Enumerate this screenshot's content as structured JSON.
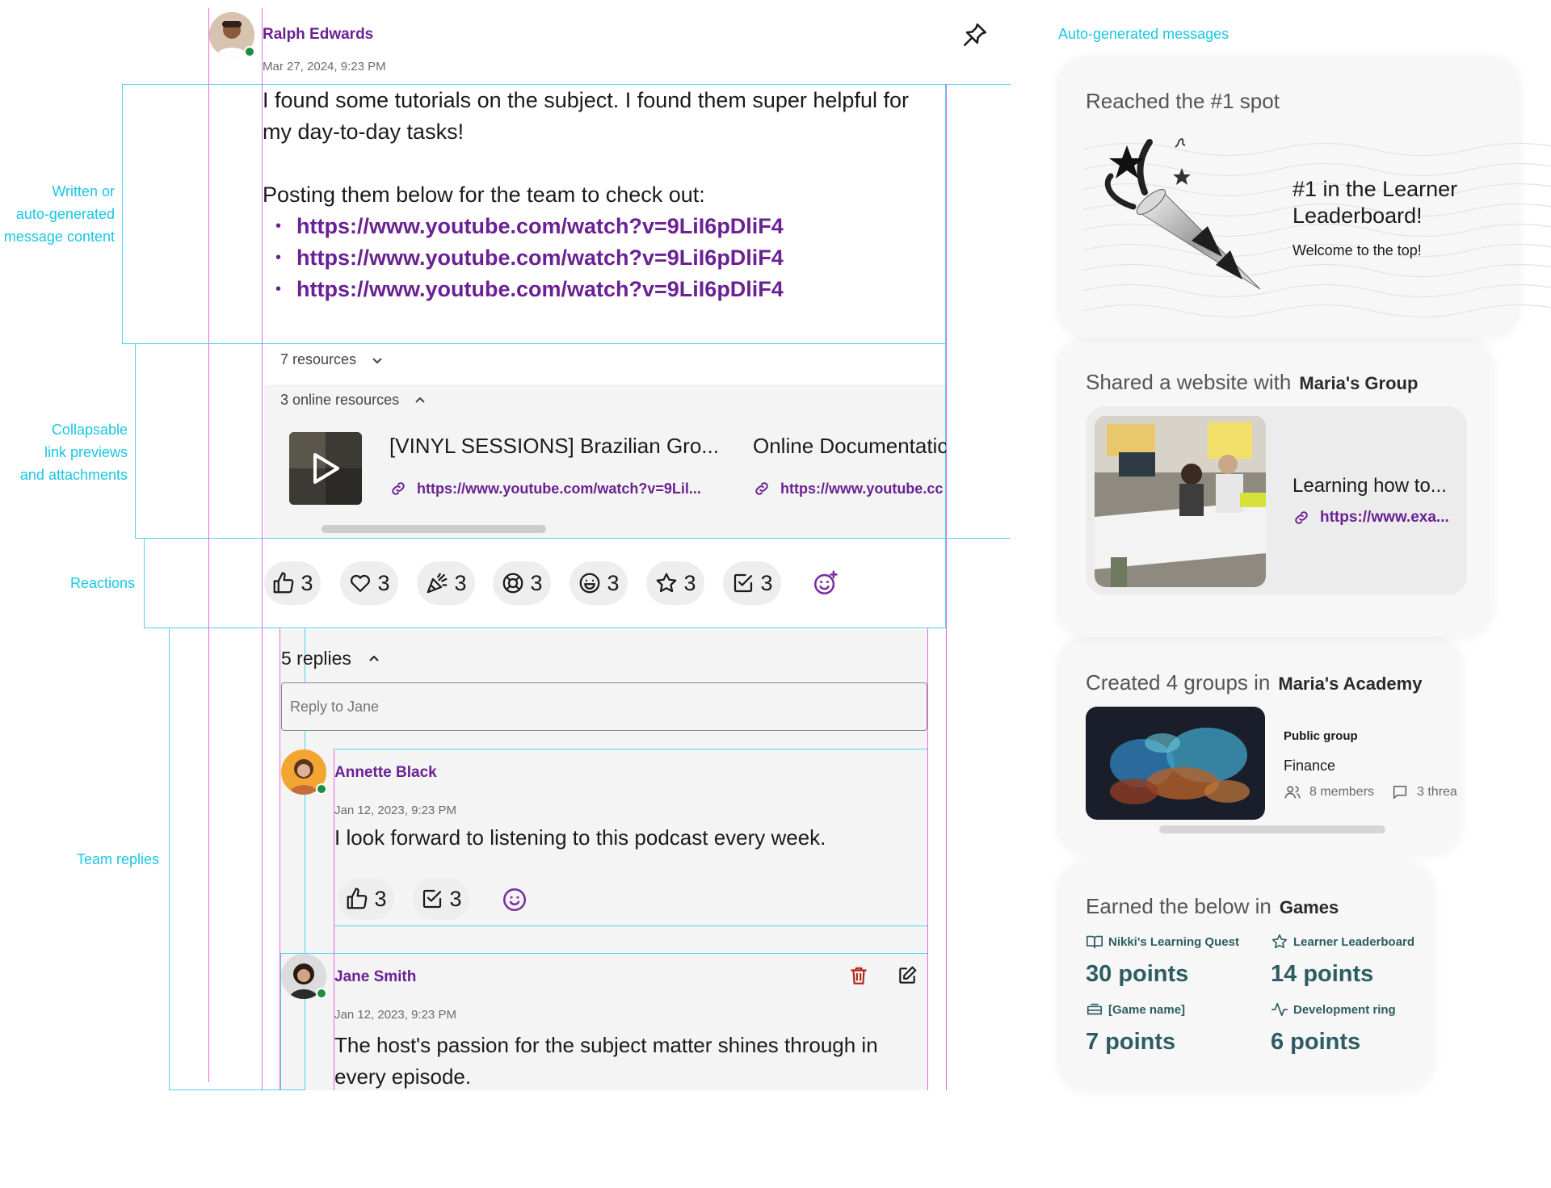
{
  "annotations": {
    "written_1": "Written or",
    "written_2": "auto-generated",
    "written_3": "message content",
    "collapsible_1": "Collapsable",
    "collapsible_2": "link previews",
    "collapsible_3": "and attachments",
    "reactions": "Reactions",
    "team_replies": "Team replies",
    "auto_generated": "Auto-generated messages"
  },
  "post": {
    "author": "Ralph Edwards",
    "timestamp": "Mar 27, 2024, 9:23 PM",
    "text_1": "I found some tutorials on the subject. I found them super helpful for my day-to-day tasks!",
    "text_2": "Posting them below for the team to check out:",
    "links": [
      "https://www.youtube.com/watch?v=9LiI6pDliF4",
      "https://www.youtube.com/watch?v=9LiI6pDliF4",
      "https://www.youtube.com/watch?v=9LiI6pDliF4"
    ]
  },
  "resources": {
    "summary": "7 resources",
    "online_header": "3 online resources",
    "items": [
      {
        "title": "[VINYL SESSIONS] Brazilian Gro...",
        "url": "https://www.youtube.com/watch?v=9Lil..."
      },
      {
        "title": "Online Documentatic",
        "url": "https://www.youtube.cc"
      }
    ]
  },
  "reactions": [
    {
      "icon": "thumbs-up-icon",
      "count": "3"
    },
    {
      "icon": "heart-icon",
      "count": "3"
    },
    {
      "icon": "party-popper-icon",
      "count": "3"
    },
    {
      "icon": "lifebuoy-icon",
      "count": "3"
    },
    {
      "icon": "grin-face-icon",
      "count": "3"
    },
    {
      "icon": "star-icon",
      "count": "3"
    },
    {
      "icon": "checkbox-icon",
      "count": "3"
    }
  ],
  "replies": {
    "header": "5 replies",
    "reply_placeholder": "Reply to Jane",
    "items": [
      {
        "author": "Annette Black",
        "timestamp": "Jan 12, 2023, 9:23 PM",
        "text": "I look forward to listening to this podcast every week.",
        "reaction_1": "3",
        "reaction_2": "3"
      },
      {
        "author": "Jane Smith",
        "timestamp": "Jan 12, 2023, 9:23 PM",
        "text": "The host's passion for the subject matter shines through in every episode."
      }
    ]
  },
  "cards": {
    "leaderboard": {
      "header": "Reached the #1 spot",
      "title": "#1 in the Learner Leaderboard!",
      "subtitle": "Welcome to the top!"
    },
    "website": {
      "header": "Shared a website with",
      "group": "Maria's Group",
      "title": "Learning how to...",
      "url": "https://www.exa..."
    },
    "groups": {
      "header": "Created 4 groups in",
      "academy": "Maria's Academy",
      "type": "Public group",
      "name": "Finance",
      "members": "8 members",
      "threads": "3 threa"
    },
    "games": {
      "header": "Earned the below in",
      "section": "Games",
      "items": [
        {
          "label": "Nikki's Learning Quest",
          "points": "30 points"
        },
        {
          "label": "Learner Leaderboard",
          "points": "14 points"
        },
        {
          "label": "[Game name]",
          "points": "7 points"
        },
        {
          "label": "Development ring",
          "points": "6 points"
        }
      ]
    }
  },
  "colors": {
    "accent_purple": "#6b2193",
    "annotation_cyan": "#19c6e6",
    "guide_magenta": "#e36ad8",
    "points_teal": "#2d5d63",
    "delete_red": "#b3261e"
  }
}
